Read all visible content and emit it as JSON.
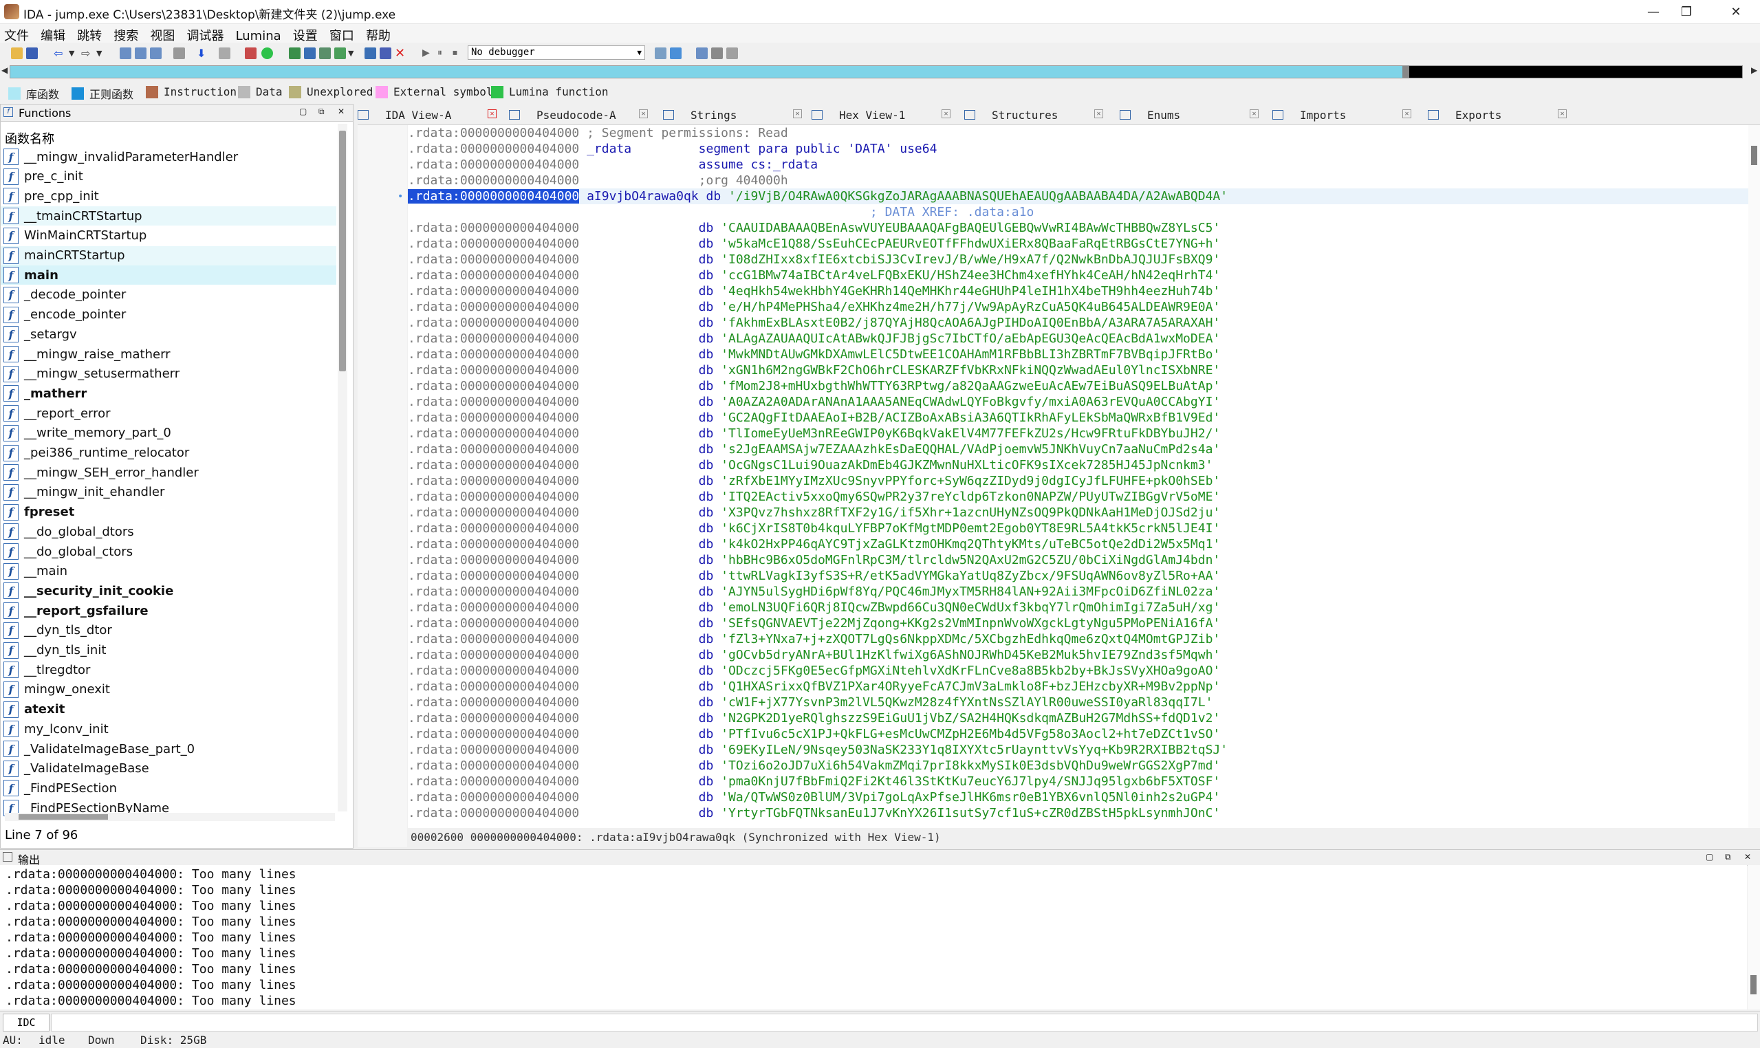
{
  "window": {
    "title": "IDA - jump.exe C:\\Users\\23831\\Desktop\\新建文件夹 (2)\\jump.exe",
    "minimize": "—",
    "maximize": "❐",
    "close": "✕"
  },
  "menu": [
    "文件",
    "编辑",
    "跳转",
    "搜索",
    "视图",
    "调试器",
    "Lumina",
    "设置",
    "窗口",
    "帮助"
  ],
  "toolbar": {
    "debugger_value": "No debugger"
  },
  "legend": [
    {
      "label": "库函数",
      "color": "#aee8f5"
    },
    {
      "label": "正则函数",
      "color": "#1a8fd8"
    },
    {
      "label": "Instruction",
      "color": "#b36a4a"
    },
    {
      "label": "Data",
      "color": "#b9b9b9"
    },
    {
      "label": "Unexplored",
      "color": "#b8b27a"
    },
    {
      "label": "External symbol",
      "color": "#ff9ef0"
    },
    {
      "label": "Lumina function",
      "color": "#2ec24a"
    }
  ],
  "functions": {
    "title": "Functions",
    "column_header": "函数名称",
    "status": "Line 7 of 96",
    "items": [
      {
        "name": "__mingw_invalidParameterHandler",
        "style": ""
      },
      {
        "name": "pre_c_init",
        "style": ""
      },
      {
        "name": "pre_cpp_init",
        "style": ""
      },
      {
        "name": "__tmainCRTStartup",
        "style": "hl"
      },
      {
        "name": "WinMainCRTStartup",
        "style": ""
      },
      {
        "name": "mainCRTStartup",
        "style": "hl"
      },
      {
        "name": "main",
        "style": "sel bold"
      },
      {
        "name": "_decode_pointer",
        "style": ""
      },
      {
        "name": "_encode_pointer",
        "style": ""
      },
      {
        "name": "_setargv",
        "style": ""
      },
      {
        "name": "__mingw_raise_matherr",
        "style": ""
      },
      {
        "name": "__mingw_setusermatherr",
        "style": ""
      },
      {
        "name": "_matherr",
        "style": "bold"
      },
      {
        "name": "__report_error",
        "style": ""
      },
      {
        "name": "__write_memory_part_0",
        "style": ""
      },
      {
        "name": "_pei386_runtime_relocator",
        "style": ""
      },
      {
        "name": "__mingw_SEH_error_handler",
        "style": ""
      },
      {
        "name": "__mingw_init_ehandler",
        "style": ""
      },
      {
        "name": "fpreset",
        "style": "bold"
      },
      {
        "name": "__do_global_dtors",
        "style": ""
      },
      {
        "name": "__do_global_ctors",
        "style": ""
      },
      {
        "name": "__main",
        "style": ""
      },
      {
        "name": "__security_init_cookie",
        "style": "bold"
      },
      {
        "name": "__report_gsfailure",
        "style": "bold"
      },
      {
        "name": "__dyn_tls_dtor",
        "style": ""
      },
      {
        "name": "__dyn_tls_init",
        "style": ""
      },
      {
        "name": "__tlregdtor",
        "style": ""
      },
      {
        "name": "mingw_onexit",
        "style": ""
      },
      {
        "name": "atexit",
        "style": "bold"
      },
      {
        "name": "my_lconv_init",
        "style": ""
      },
      {
        "name": "_ValidateImageBase_part_0",
        "style": ""
      },
      {
        "name": "_ValidateImageBase",
        "style": ""
      },
      {
        "name": "_FindPESection",
        "style": ""
      },
      {
        "name": "_FindPESectionByName",
        "style": ""
      }
    ]
  },
  "tabs": [
    {
      "label": "IDA View-A",
      "active": true
    },
    {
      "label": "Pseudocode-A",
      "active": false
    },
    {
      "label": "Strings",
      "active": false
    },
    {
      "label": "Hex View-1",
      "active": false
    },
    {
      "label": "Structures",
      "active": false
    },
    {
      "label": "Enums",
      "active": false
    },
    {
      "label": "Imports",
      "active": false
    },
    {
      "label": "Exports",
      "active": false
    }
  ],
  "disasm": {
    "header_lines": [
      {
        "addr": ".rdata:0000000000404000",
        "text": " ; Segment permissions: Read",
        "kind": "cmt"
      },
      {
        "addr": ".rdata:0000000000404000",
        "label": " _rdata",
        "text": "segment para public 'DATA' use64",
        "kind": "kw"
      },
      {
        "addr": ".rdata:0000000000404000",
        "label": "",
        "text": "assume cs:_rdata",
        "kind": "kw"
      },
      {
        "addr": ".rdata:0000000000404000",
        "label": "",
        "text": ";org 404000h",
        "kind": "cmt"
      }
    ],
    "current": {
      "addr": ".rdata:0000000000404000",
      "label": "aI9vjbO4rawa0qk",
      "op": "db",
      "str": "'/i9VjB/O4RAwA0QKSGkgZoJARAgAAABNASQUEhAEAUQgAABAABA4DA/A2AwABQD4A'",
      "xref": "; DATA XREF: .data:a1o"
    },
    "addr": ".rdata:0000000000404000",
    "op": "db",
    "strings": [
      "'CAAUIDABAAAQBEnAswVUYEUBAAAQAFgBAQEUlGEBQwVwRI4BAwWcTHBBQwZ8YLsC5'",
      "'w5kaMcE1Q88/SsEuhCEcPAEURvEOTfFFhdwUXiERx8QBaaFaRqEtRBGsCtE7YNG+h'",
      "'I08dZHIxx8xfIE6xtcbiSJ3CvIrevJ/B/wWe/H9xA7f/Q2NwkBnDbAJQJUJFsBXQ9'",
      "'ccG1BMw74aIBCtAr4veLFQBxEKU/HShZ4ee3HChm4xefHYhk4CeAH/hN42eqHrhT4'",
      "'4eqHkh54wekHbhY4GeKHRh14QeMHKhr44eGHUhP4leIH1hX4beTH9hh4eezHuh74b'",
      "'e/H/hP4MePHSha4/eXHKhz4me2H/h77j/Vw9ApAyRzCuA5QK4uB645ALDEAWR9E0A'",
      "'fAkhmExBLAsxtE0B2/j87QYAjH8QcAOA6AJgPIHDoAIQ0EnBbA/A3ARA7A5ARAXAH'",
      "'ALAgAZAUAAQUIcAtABwkQJFJBjgSc7IbCTfO/aEbApEGU3QeAcQEAcBdA1wxMoDEA'",
      "'MwkMNDtAUwGMkDXAmwLElC5DtwEE1COAHAmM1RFBbBLI3hZBRTmF7BVBqipJFRtBo'",
      "'xGN1h6M2ngGWBkF2ChO6hrCLESKARZFfVbKRxNFkiNQQzWwadAEul0YlncISXbNRE'",
      "'fMom2J8+mHUxbgthWhWTTY63RPtwg/a82QaAAGzweEuAcAEw7EiBuASQ9ELBuAtAp'",
      "'A0AZA2A0ADArANAnA1AAA5ANEqCWAdwLQYFoBkgvfy/mxiA0A63rEVQuA0CCAbgYI'",
      "'GC2AQgFItDAAEAoI+B2B/ACIZBoAxABsiA3A6QTIkRhAFyLEkSbMaQWRxBfB1V9Ed'",
      "'TlIomeEyUeM3nREeGWIP0yK6BqkVakElV4M77FEFkZU2s/Hcw9FRtuFkDBYbuJH2/'",
      "'s2JgEAAMSAjw7EZAAAzhkEsDaEQQHAL/VAdPjoemvW5JNKhVuyCn7aaNuCmPd2s4a'",
      "'OcGNgsC1Lui9OuazAkDmEb4GJKZMwnNuHXLticOFK9sIXcek7285HJ45JpNcnkm3'",
      "'zRfXbE1MYyIMzXUc9SnyvPPYforc+SyW6qzZIDyd9j0dgICyJfLFUHFE+pkO0hSEb'",
      "'ITQ2EActiv5xxoQmy6SQwPR2y37reYcldp6Tzkon0NAPZW/PUyUTwZIBGgVrV5oME'",
      "'X3PQvz7hshxz8RfTXF2y1G/if5Xhr+1azcnUHyNZsOQ9PkQDNkAaH1MeDjOJSd2ju'",
      "'k6CjXrIS8T0b4kquLYFBP7oKfMgtMDP0emt2Egob0YT8E9RL5A4tkK5crkN5lJE4I'",
      "'k4kO2HxPP46qAYC9TjxZaGLKtzmOHKmq2QThtyKMts/uTeBC5otQe2dDi2W5x5Mq1'",
      "'hbBHc9B6xO5doMGFnlRpC3M/tlrcldw5N2QAxU2mG2C5ZU/0bCiXiNgdGlAmJ4bdn'",
      "'ttwRLVagkI3yfS3S+R/etK5adVYMGkaYatUq8ZyZbcx/9FSUqAWN6ov8yZl5Ro+AA'",
      "'AJYN5ulSygHDi6pWf8Yq/PQC46mJMyxTM5RH84lAN+92Aii3MFpcOiD6ZfiNL02za'",
      "'emoLN3UQFi6QRj8IQcwZBwpd66Cu3QN0eCWdUxf3kbqY7lrQmOhimIgi7Za5uH/xg'",
      "'SEfsQGNVAEVTje22MjZqong+KKg2s2VmMInpnWvoWXgckLgtyNgu5PMoPENiA16fA'",
      "'fZl3+YNxa7+j+zXQOT7LgQs6NkppXDMc/5XCbgzhEdhkqQme6zQxtQ4MOmtGPJZib'",
      "'gOCvb5dryANrA+BUl1HzKlfwiXg6AShNOJRWhD45KeB2Muk5hvIE79Znd3sf5Mqwh'",
      "'ODczcj5FKg0E5ecGfpMGXiNtehlvXdKrFLnCve8a8B5kb2by+BkJsSVyXHOa9goAO'",
      "'Q1HXASrixxQfBVZ1PXar4ORyyeFcA7CJmV3aLmklo8F+bzJEHzcbyXR+M9Bv2ppNp'",
      "'cW1F+jX77YsvnP3m2lVL5QKwzM28z4fYXntNsSZlAYlR00uweSSI0yaRl83qqI7L'",
      "'N2GPK2D1yeRQlghszzS9EiGuU1jVbZ/SA2H4HQKsdkqmAZBuH2G7MdhSS+fdQD1v2'",
      "'PTfIvu6c5cX1PJ+QkFLG+esMcUwCMZpH2E6Mb4d5VFg58o3Aocl2+ht7eDZCt1vSO'",
      "'69EKyILeN/9Nsqey503NaSK233Y1q8IXYXtc5rUaynttvVsYyq+Kb9R2RXIBB2tqSJ'",
      "'TOzi6o2oJD7uXi6h54VakmZMqi7prI8kkxMySIk0E3dsbVQhDu9weWrGGS2XgP7md'",
      "'pma0KnjU7fBbFmiQ2Fi2Kt46l3StKtKu7eucY6J7lpy4/SNJJq95lgxb6bF5XTOSF'",
      "'Wa/QTwWS0z0BlUM/3Vpi7goLqAxPfseJlHK6msr0eB1YBX6vnlQ5Nl0inh2s2uGP4'",
      "'YrtyrTGbFQTNksanEu1J7vKnYX26I1sutSy7cf1uS+cZR0dZBStH5pkLsynmhJOnC'"
    ],
    "status": "00002600 0000000000404000: .rdata:aI9vjbO4rawa0qk (Synchronized with Hex View-1)"
  },
  "output": {
    "title": "输出",
    "line": ".rdata:0000000000404000: Too many lines",
    "count": 9
  },
  "idc": {
    "button": "IDC"
  },
  "statusbar": {
    "au": "AU:",
    "state": "idle",
    "dir": "Down",
    "disk": "Disk: 25GB"
  }
}
